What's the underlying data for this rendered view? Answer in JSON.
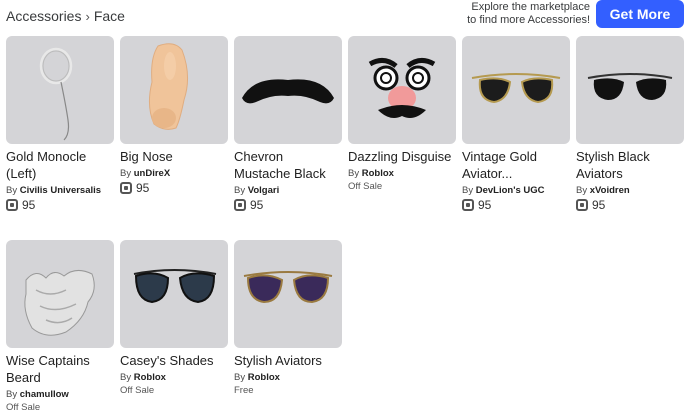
{
  "breadcrumb": {
    "root": "Accessories",
    "separator": "›",
    "current": "Face"
  },
  "promo": {
    "line1": "Explore the marketplace",
    "line2": "to find more Accessories!",
    "button": "Get More"
  },
  "items": [
    {
      "name": "Gold Monocle (Left)",
      "by": "By",
      "creator": "Civilis Universalis",
      "price": "95",
      "status": ""
    },
    {
      "name": "Big Nose",
      "by": "By",
      "creator": "unDireX",
      "price": "95",
      "status": ""
    },
    {
      "name": "Chevron Mustache Black",
      "by": "By",
      "creator": "Volgari",
      "price": "95",
      "status": ""
    },
    {
      "name": "Dazzling Disguise",
      "by": "By",
      "creator": "Roblox",
      "price": "",
      "status": "Off Sale"
    },
    {
      "name": "Vintage Gold Aviator...",
      "by": "By",
      "creator": "DevLion's UGC",
      "price": "95",
      "status": ""
    },
    {
      "name": "Stylish Black Aviators",
      "by": "By",
      "creator": "xVoidren",
      "price": "95",
      "status": ""
    },
    {
      "name": "Wise Captains Beard",
      "by": "By",
      "creator": "chamullow",
      "price": "",
      "status": "Off Sale"
    },
    {
      "name": "Casey's Shades",
      "by": "By",
      "creator": "Roblox",
      "price": "",
      "status": "Off Sale"
    },
    {
      "name": "Stylish Aviators",
      "by": "By",
      "creator": "Roblox",
      "price": "",
      "status": "Free"
    }
  ]
}
